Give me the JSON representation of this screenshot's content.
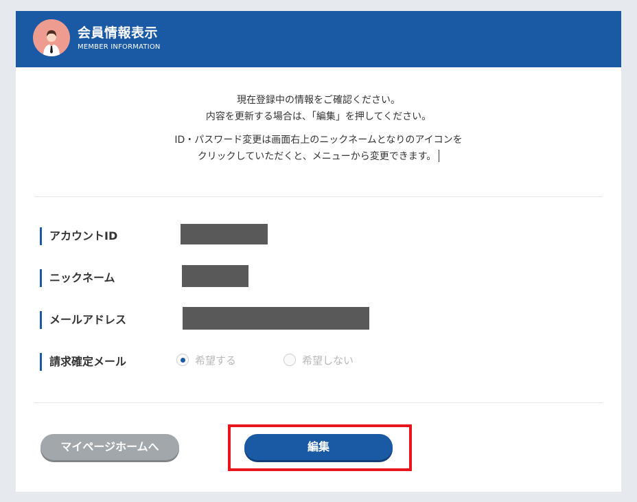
{
  "header": {
    "title": "会員情報表示",
    "subtitle": "MEMBER INFORMATION",
    "avatar_icon": "user-avatar-icon"
  },
  "intro": {
    "line1": "現在登録中の情報をご確認ください。",
    "line2": "内容を更新する場合は、「編集」を押してください。",
    "line3": "ID・パスワード変更は画面右上のニックネームとなりのアイコンを",
    "line4": "クリックしていただくと、メニューから変更できます。"
  },
  "fields": {
    "account_id_label": "アカウントID",
    "nickname_label": "ニックネーム",
    "email_label": "メールアドレス",
    "billing_mail_label": "請求確定メール"
  },
  "billing_mail": {
    "option_yes": "希望する",
    "option_no": "希望しない",
    "selected": "希望する"
  },
  "buttons": {
    "home_label": "マイページホームへ",
    "edit_label": "編集"
  },
  "colors": {
    "primary": "#1a5aa5",
    "highlight": "#e8141c",
    "avatar_bg": "#ee9b90",
    "home_button": "#a2a7ab"
  }
}
